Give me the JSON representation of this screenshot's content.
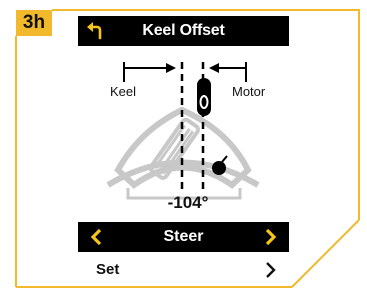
{
  "step": {
    "badge": "3h"
  },
  "header": {
    "title": "Keel Offset",
    "back_icon": "back-arrow-icon"
  },
  "diagram": {
    "left_label": "Keel",
    "right_label": "Motor",
    "angle_readout": "-104°"
  },
  "mode_selector": {
    "label": "Steer",
    "left_icon": "chevron-left-icon",
    "right_icon": "chevron-right-icon"
  },
  "set_row": {
    "label": "Set",
    "icon": "chevron-right-icon"
  },
  "colors": {
    "accent": "#f3b92c",
    "bar_background": "#000000",
    "arrow_yellow": "#f5c518",
    "diagram_gray": "#c8c8c8"
  }
}
